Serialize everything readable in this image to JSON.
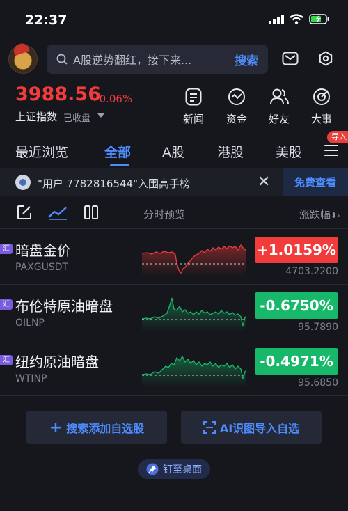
{
  "status_bar": {
    "time": "22:37"
  },
  "search": {
    "placeholder": "A股逆势翻红，接下来...",
    "button_label": "搜索"
  },
  "index": {
    "value": "3988.56",
    "change": "+0.06%",
    "name": "上证指数",
    "status": "已收盘"
  },
  "quick_actions": [
    {
      "label": "新闻",
      "icon": "news-icon"
    },
    {
      "label": "资金",
      "icon": "fund-icon"
    },
    {
      "label": "好友",
      "icon": "friends-icon"
    },
    {
      "label": "大事",
      "icon": "events-icon"
    }
  ],
  "import_badge": "导入",
  "tabs": [
    {
      "label": "最近浏览",
      "active": false
    },
    {
      "label": "全部",
      "active": true
    },
    {
      "label": "A股",
      "active": false
    },
    {
      "label": "港股",
      "active": false
    },
    {
      "label": "美股",
      "active": false
    }
  ],
  "banner": {
    "text": "\"用户 7782816544\"入围高手榜",
    "cta": "免费查看"
  },
  "list_header": {
    "chart_title": "分时预览",
    "sort_label": "涨跌幅"
  },
  "rows": [
    {
      "tag": "汇",
      "name": "暗盘金价",
      "code": "PAXGUSDT",
      "change": "+1.0159%",
      "price": "4703.2200",
      "direction": "up"
    },
    {
      "tag": "汇",
      "name": "布伦特原油暗盘",
      "code": "OILNP",
      "change": "-0.6750%",
      "price": "95.7890",
      "direction": "down"
    },
    {
      "tag": "汇",
      "name": "纽约原油暗盘",
      "code": "WTINP",
      "change": "-0.4971%",
      "price": "95.6850",
      "direction": "down"
    }
  ],
  "bottom": {
    "add_label": "搜索添加自选股",
    "ai_label": "AI识图导入自选",
    "pin_label": "钉至桌面"
  },
  "colors": {
    "up": "#f23b3b",
    "down": "#18b86a",
    "accent": "#4d8cff",
    "background": "#16171c"
  }
}
